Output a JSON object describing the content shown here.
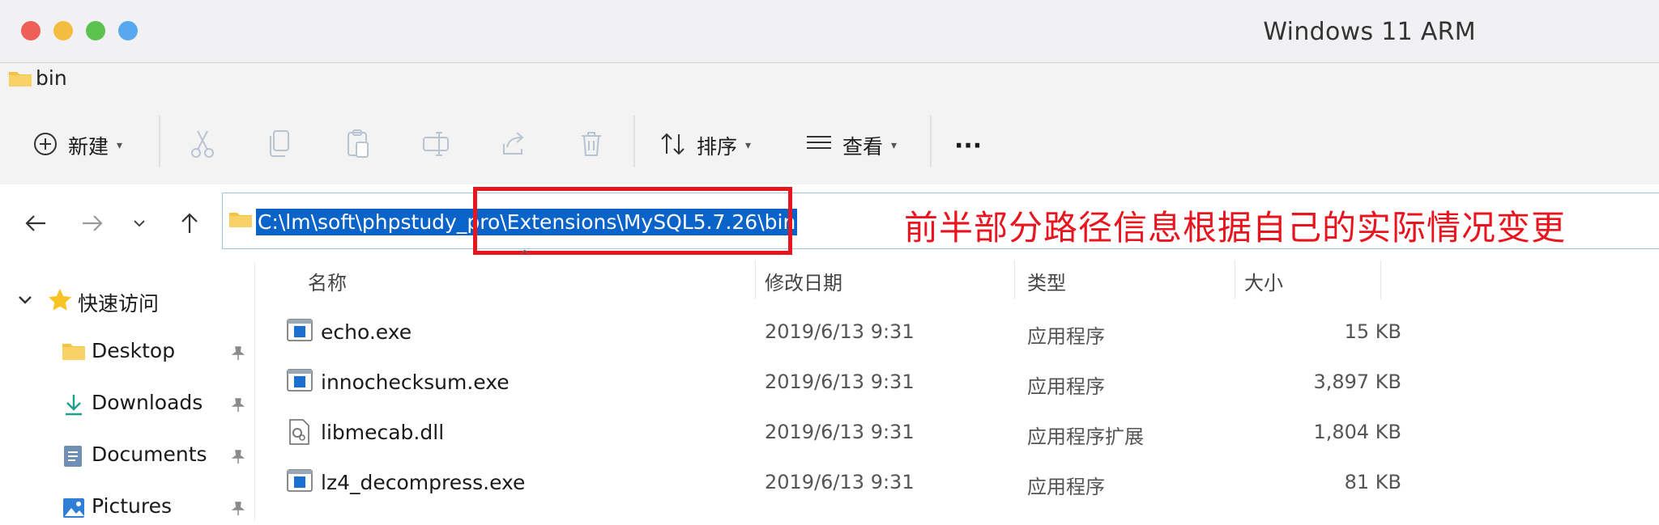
{
  "window": {
    "title": "Windows 11 ARM"
  },
  "explorer_tab": {
    "label": "bin"
  },
  "command_bar": {
    "new_label": "新建",
    "sort_label": "排序",
    "view_label": "查看",
    "more_label": "···"
  },
  "address_bar": {
    "path": "C:\\lm\\soft\\phpstudy_pro\\Extensions\\MySQL5.7.26\\bin"
  },
  "annotation": {
    "text": "前半部分路径信息根据自己的实际情况变更",
    "color": "#e8141e"
  },
  "sidebar": {
    "quick_access_label": "快速访问",
    "items": [
      {
        "label": "Desktop",
        "icon": "folder-icon"
      },
      {
        "label": "Downloads",
        "icon": "download-icon"
      },
      {
        "label": "Documents",
        "icon": "document-icon"
      },
      {
        "label": "Pictures",
        "icon": "pictures-icon"
      }
    ]
  },
  "file_list": {
    "columns": {
      "name": "名称",
      "date": "修改日期",
      "type": "类型",
      "size": "大小"
    },
    "rows": [
      {
        "name": "echo.exe",
        "date": "2019/6/13 9:31",
        "type": "应用程序",
        "size": "15 KB",
        "icon": "exe-icon"
      },
      {
        "name": "innochecksum.exe",
        "date": "2019/6/13 9:31",
        "type": "应用程序",
        "size": "3,897 KB",
        "icon": "exe-icon"
      },
      {
        "name": "libmecab.dll",
        "date": "2019/6/13 9:31",
        "type": "应用程序扩展",
        "size": "1,804 KB",
        "icon": "dll-icon"
      },
      {
        "name": "lz4_decompress.exe",
        "date": "2019/6/13 9:31",
        "type": "应用程序",
        "size": "81 KB",
        "icon": "exe-icon"
      }
    ]
  },
  "colors": {
    "accent": "#0a63c9",
    "annotation_red": "#e8141e",
    "folder_yellow": "#f5c342"
  }
}
